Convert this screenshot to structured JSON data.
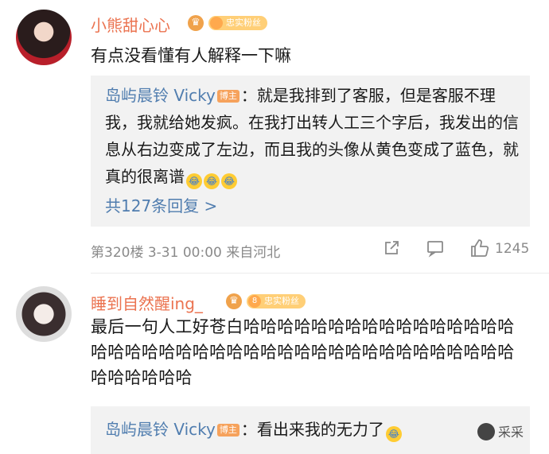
{
  "comments": [
    {
      "username": "小熊甜心心",
      "fan_level": "",
      "fan_badge": "忠实粉丝",
      "text": "有点没看懂有人解释一下嘛",
      "reply": {
        "author": "岛屿晨铃 Vicky",
        "author_badge": "博主",
        "text": "：就是我排到了客服，但是客服不理我，我就给她发疯。在我打出转人工三个字后，我发出的信息从右边变成了左边，而且我的头像从黄色变成了蓝色，就真的很离谱",
        "emoji_count": 3
      },
      "more_replies": "共127条回复 >",
      "meta": "第320楼 3-31 00:00 来自河北",
      "likes": "1245"
    },
    {
      "username": "睡到自然醒ing_",
      "fan_level": "8",
      "fan_badge": "忠实粉丝",
      "text": "最后一句人工好苍白哈哈哈哈哈哈哈哈哈哈哈哈哈哈哈哈哈哈哈哈哈哈哈哈哈哈哈哈哈哈哈哈哈哈哈哈哈哈哈哈哈哈哈哈哈哈哈",
      "reply": {
        "author": "岛屿晨铃 Vicky",
        "author_badge": "博主",
        "text": "：看出来我的无力了",
        "emoji_count": 1
      }
    }
  ],
  "watermark": "采采",
  "icons": {
    "share": "share-icon",
    "comment": "comment-icon",
    "like": "thumbs-up-icon",
    "crown": "crown-icon",
    "emoji": "crying-laughing-emoji"
  },
  "colors": {
    "username": "#eb7350",
    "link": "#507daf",
    "meta": "#8a8a8a",
    "reply_bg": "#f2f2f2"
  }
}
